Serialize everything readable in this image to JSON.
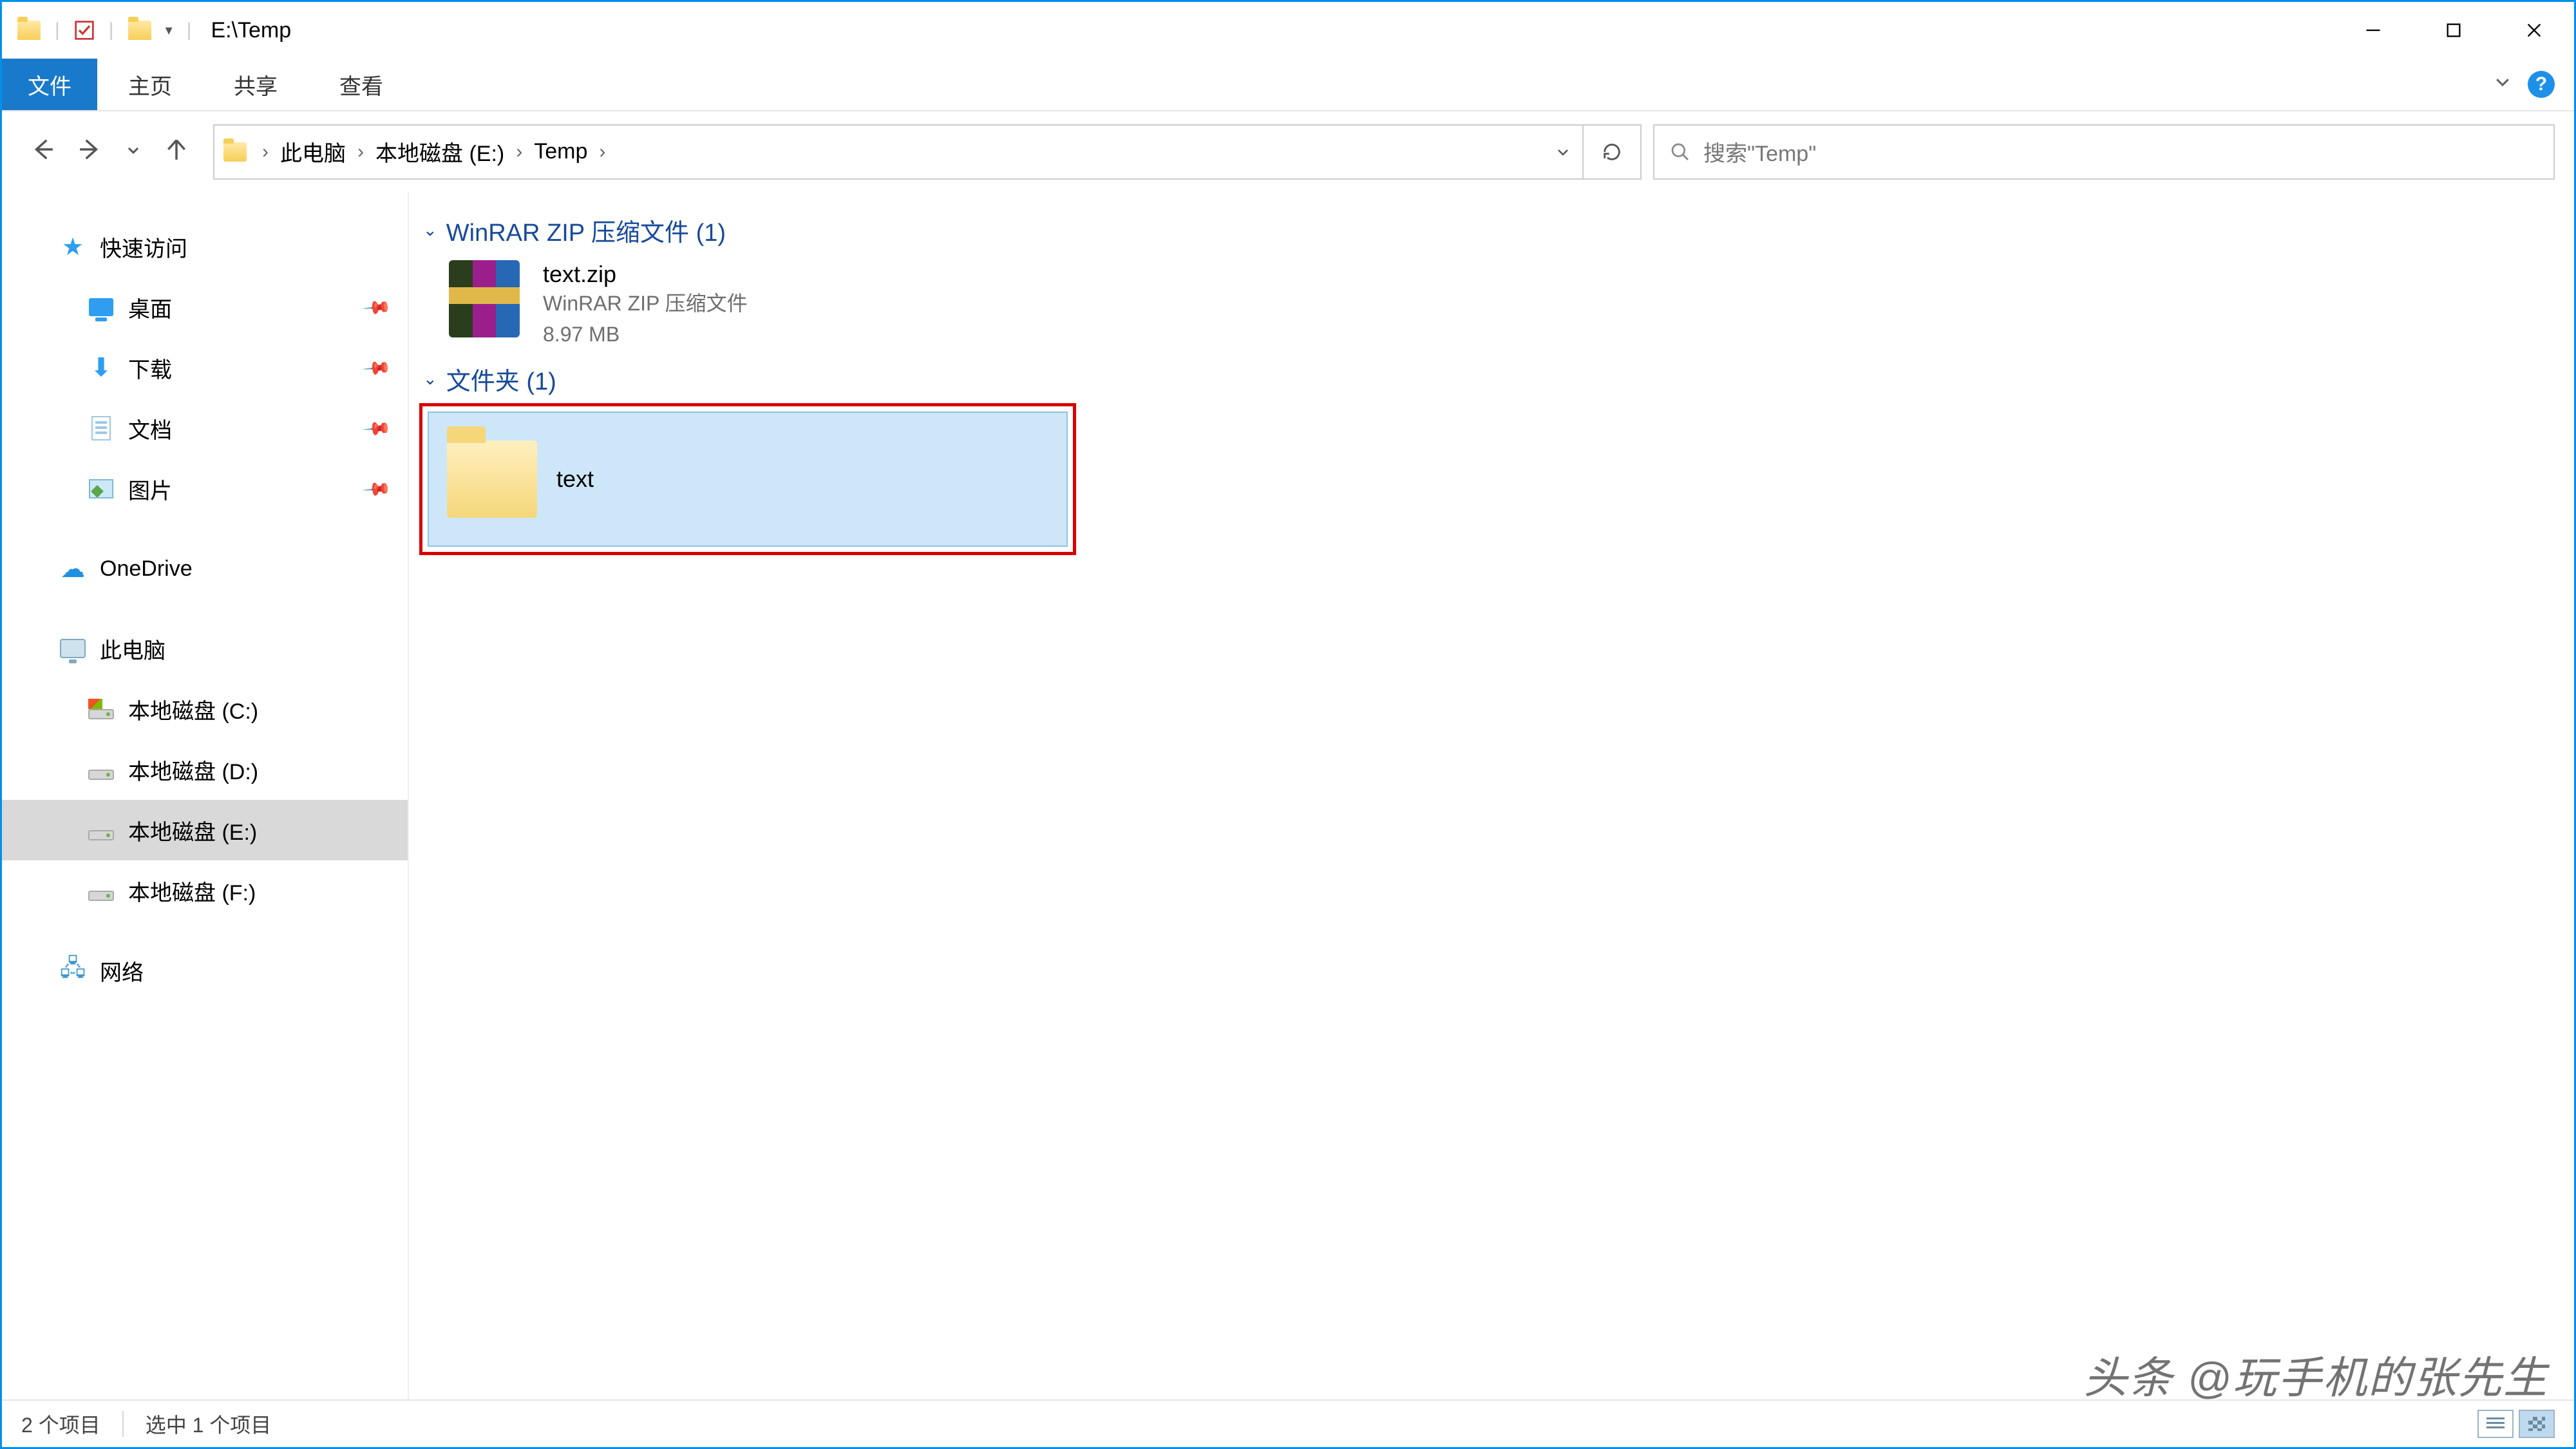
{
  "title_path": "E:\\Temp",
  "ribbon": {
    "file": "文件",
    "home": "主页",
    "share": "共享",
    "view": "查看"
  },
  "breadcrumb": {
    "this_pc": "此电脑",
    "drive": "本地磁盘 (E:)",
    "folder": "Temp"
  },
  "search": {
    "placeholder": "搜索\"Temp\""
  },
  "sidebar": {
    "quick_access": "快速访问",
    "desktop": "桌面",
    "downloads": "下载",
    "documents": "文档",
    "pictures": "图片",
    "onedrive": "OneDrive",
    "this_pc": "此电脑",
    "drive_c": "本地磁盘 (C:)",
    "drive_d": "本地磁盘 (D:)",
    "drive_e": "本地磁盘 (E:)",
    "drive_f": "本地磁盘 (F:)",
    "network": "网络"
  },
  "groups": {
    "zip_header": "WinRAR ZIP 压缩文件 (1)",
    "folder_header": "文件夹 (1)"
  },
  "zip_file": {
    "name": "text.zip",
    "type": "WinRAR ZIP 压缩文件",
    "size": "8.97 MB"
  },
  "folder_file": {
    "name": "text"
  },
  "status": {
    "items": "2 个项目",
    "selected": "选中 1 个项目"
  },
  "watermark": "头条 @玩手机的张先生"
}
